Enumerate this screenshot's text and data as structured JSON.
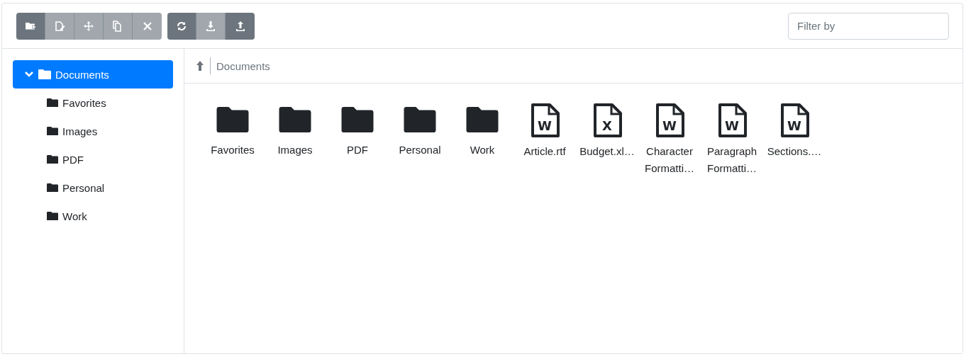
{
  "toolbar": {
    "groups": [
      [
        {
          "kind": "new-folder",
          "disabled": false
        },
        {
          "kind": "rename",
          "disabled": true
        },
        {
          "kind": "move",
          "disabled": true
        },
        {
          "kind": "copy",
          "disabled": true
        },
        {
          "kind": "delete",
          "disabled": true
        }
      ],
      [
        {
          "kind": "refresh",
          "disabled": false
        },
        {
          "kind": "download",
          "disabled": true
        },
        {
          "kind": "upload",
          "disabled": false
        }
      ]
    ],
    "filter": {
      "placeholder": "Filter by"
    }
  },
  "tree": [
    {
      "label": "Documents",
      "selected": true,
      "expanded": true,
      "children": [
        {
          "label": "Favorites",
          "selected": false
        },
        {
          "label": "Images",
          "selected": false
        },
        {
          "label": "PDF",
          "selected": false
        },
        {
          "label": "Personal",
          "selected": false
        },
        {
          "label": "Work",
          "selected": false
        }
      ]
    }
  ],
  "breadcrumb": {
    "path": "Documents"
  },
  "items": [
    {
      "kind": "folder",
      "name": "Favorites"
    },
    {
      "kind": "folder",
      "name": "Images"
    },
    {
      "kind": "folder",
      "name": "PDF"
    },
    {
      "kind": "folder",
      "name": "Personal"
    },
    {
      "kind": "folder",
      "name": "Work"
    },
    {
      "kind": "file",
      "letter": "W",
      "name": "Article.rtf"
    },
    {
      "kind": "file",
      "letter": "X",
      "name": "Budget.xl…"
    },
    {
      "kind": "file",
      "letter": "W",
      "name": "Character Formatti…"
    },
    {
      "kind": "file",
      "letter": "W",
      "name": "Paragraph Formatti…"
    },
    {
      "kind": "file",
      "letter": "W",
      "name": "Sections.…"
    }
  ]
}
